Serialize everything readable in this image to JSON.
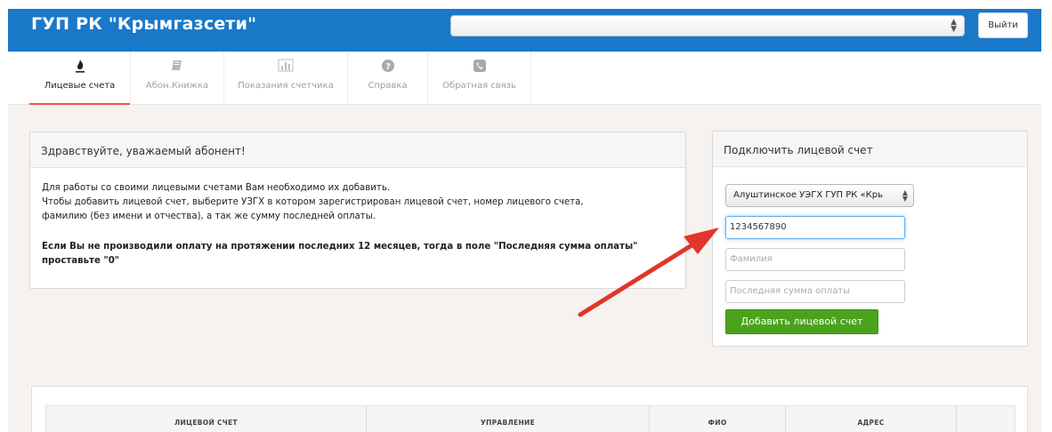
{
  "header": {
    "title": "ГУП РК \"Крымгазсети\"",
    "select_value": "",
    "logout_label": "Выйти"
  },
  "tabs": [
    {
      "label": "Лицевые счета",
      "icon": "flame-icon",
      "active": true
    },
    {
      "label": "Абон.Книжка",
      "icon": "book-icon",
      "active": false
    },
    {
      "label": "Показания счетчика",
      "icon": "bar-chart-icon",
      "active": false
    },
    {
      "label": "Справка",
      "icon": "help-icon",
      "active": false
    },
    {
      "label": "Обратная связь",
      "icon": "phone-icon",
      "active": false
    }
  ],
  "welcome": {
    "title": "Здравствуйте, уважаемый абонент!",
    "line1": "Для работы со своими лицевыми счетами Вам необходимо их добавить.",
    "line2": "Чтобы добавить лицевой счет, выберите УЗГХ в котором зарегистрирован лицевой счет, номер лицевого счета,",
    "line3": "фамилию (без имени и отчества), а так же сумму последней оплаты.",
    "note1": "Если Вы не производили оплату на протяжении последних 12 месяцев, тогда в поле \"Последняя сумма оплаты\"",
    "note2": "проставьте \"0\""
  },
  "connect": {
    "title": "Подключить лицевой счет",
    "department_selected": "Алуштинское УЭГХ ГУП РК «Крь",
    "account_value": "1234567890",
    "surname_placeholder": "Фамилия",
    "last_payment_placeholder": "Последняя сумма оплаты",
    "add_button": "Добавить лицевой счет"
  },
  "table": {
    "columns": [
      "ЛИЦЕВОЙ СЧЕТ",
      "УПРАВЛЕНИЕ",
      "ФИО",
      "АДРЕС",
      ""
    ]
  },
  "colors": {
    "topbar": "#1a78c8",
    "active_tab_underline": "#e25a4f",
    "add_button": "#4aa31b",
    "annotation_arrow": "#e2352b"
  }
}
